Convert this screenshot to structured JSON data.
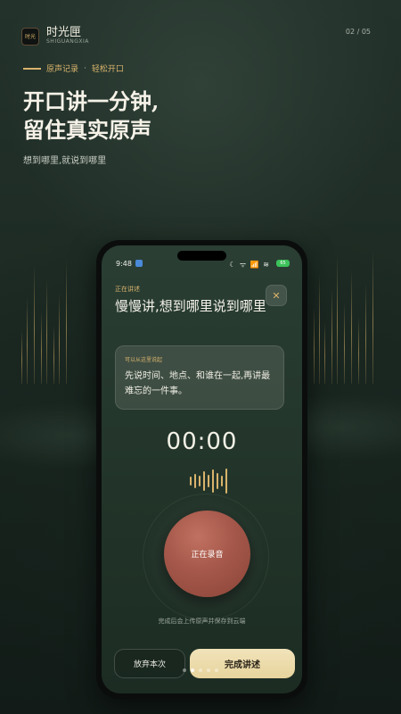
{
  "brand": {
    "logo_text": "时光",
    "name": "时光匣",
    "sub": "SHIGUANGXIA"
  },
  "pager": {
    "text": "02 / 05",
    "current": 2,
    "total": 5
  },
  "tagline": {
    "primary": "原声记录",
    "separator": "·",
    "secondary": "轻松开口"
  },
  "headline": {
    "line1": "开口讲一分钟,",
    "line2": "留住真实原声"
  },
  "subline": "想到哪里,就说到哪里",
  "phone": {
    "status": {
      "time": "9:48",
      "right": "☾ ᯤ 📶 ≋",
      "battery": "65"
    },
    "recording_label": "正在讲述",
    "close_glyph": "✕",
    "title": "慢慢讲,想到哪里说到哪里",
    "prompt": {
      "label": "可以从这里说起",
      "text": "先说时间、地点、和谁在一起,再讲最难忘的一件事。"
    },
    "timer": "00:00",
    "record_button": "正在录音",
    "hint": "完成后会上传原声并保存到云端",
    "discard_button": "放弃本次",
    "finish_button": "完成讲述"
  },
  "icons": {
    "close": "close-icon",
    "waveform": "waveform-icon",
    "logo": "logo-icon"
  },
  "colors": {
    "accent": "#d9b36c",
    "record": "#a4574a",
    "finish": "#efe0b3",
    "background": "#1d2a24"
  }
}
